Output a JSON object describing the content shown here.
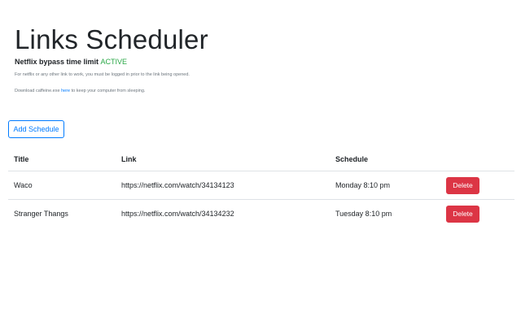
{
  "header": {
    "title": "Links Scheduler",
    "bypass_label": "Netflix bypass time limit",
    "bypass_status": "ACTIVE",
    "hint_line1": "For netflix or any other link to work, you must be logged in prior to the link being opened.",
    "hint_prefix": "Download caffeine.exe",
    "hint_link": "here",
    "hint_suffix": "to keep your computer from sleeping."
  },
  "toolbar": {
    "add_label": "Add Schedule"
  },
  "table": {
    "columns": [
      "Title",
      "Link",
      "Schedule",
      ""
    ],
    "rows": [
      {
        "title": "Waco",
        "link": "https://netflix.com/watch/34134123",
        "schedule": "Monday 8:10 pm",
        "action": "Delete"
      },
      {
        "title": "Stranger Thangs",
        "link": "https://netflix.com/watch/34134232",
        "schedule": "Tuesday 8:10 pm",
        "action": "Delete"
      }
    ]
  },
  "colors": {
    "primary": "#007bff",
    "danger": "#dc3545",
    "success": "#28a745"
  }
}
